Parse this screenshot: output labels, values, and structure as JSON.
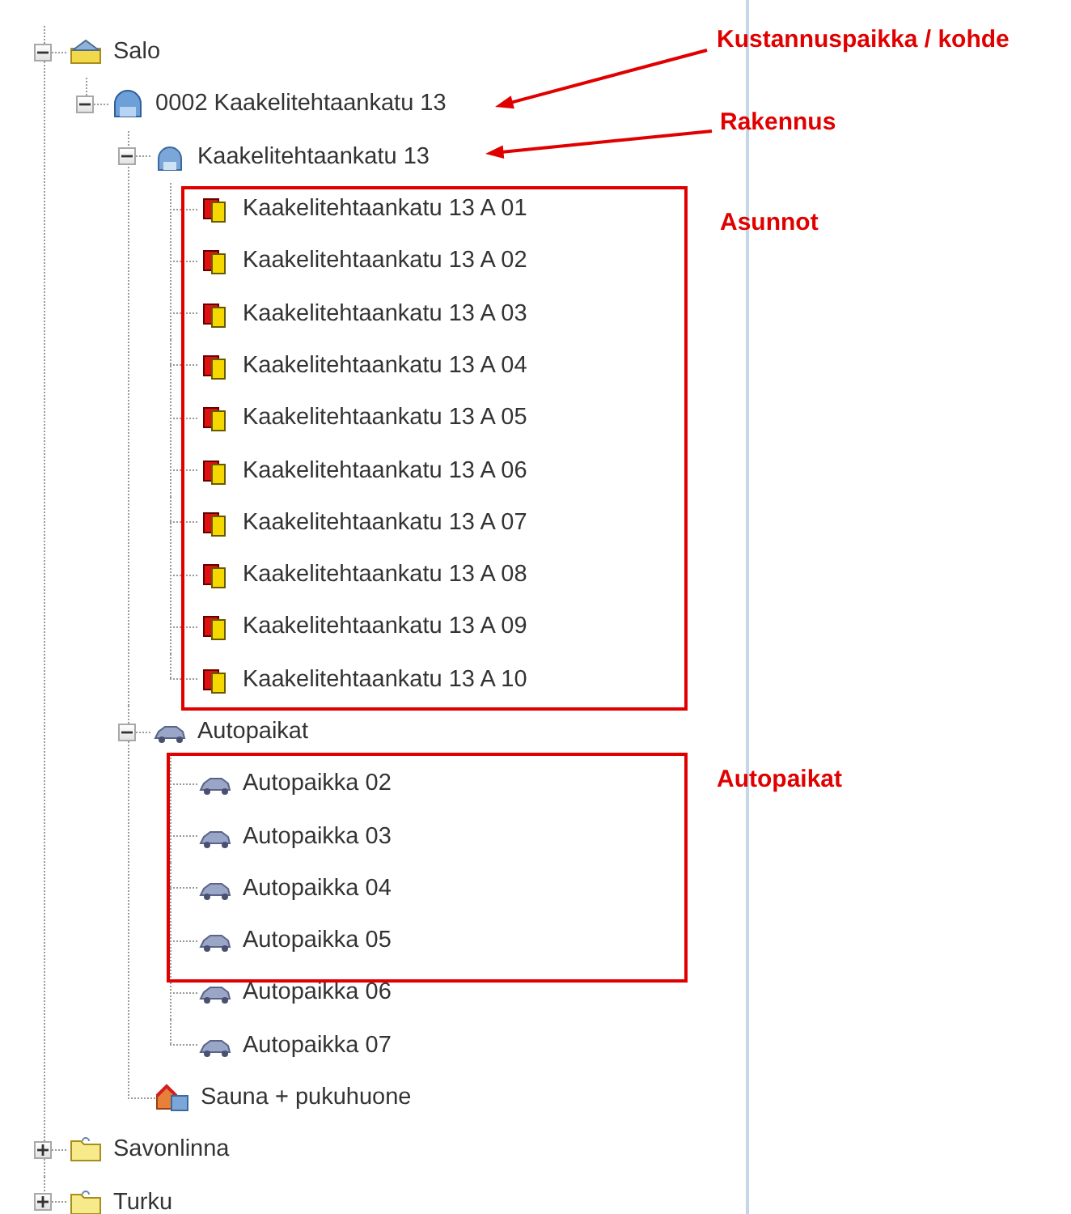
{
  "tree": [
    {
      "label": "Salo",
      "kind": "city",
      "expanded": true,
      "children": [
        {
          "label": "0002 Kaakelitehtaankatu 13",
          "kind": "property",
          "expanded": true,
          "children": [
            {
              "label": "Kaakelitehtaankatu 13",
              "kind": "building",
              "expanded": true,
              "children": [
                {
                  "label": "Kaakelitehtaankatu 13 A 01",
                  "kind": "apartment"
                },
                {
                  "label": "Kaakelitehtaankatu 13 A 02",
                  "kind": "apartment"
                },
                {
                  "label": "Kaakelitehtaankatu 13 A 03",
                  "kind": "apartment"
                },
                {
                  "label": "Kaakelitehtaankatu 13 A 04",
                  "kind": "apartment"
                },
                {
                  "label": "Kaakelitehtaankatu 13 A 05",
                  "kind": "apartment"
                },
                {
                  "label": "Kaakelitehtaankatu 13 A 06",
                  "kind": "apartment"
                },
                {
                  "label": "Kaakelitehtaankatu 13 A 07",
                  "kind": "apartment"
                },
                {
                  "label": "Kaakelitehtaankatu 13 A 08",
                  "kind": "apartment"
                },
                {
                  "label": "Kaakelitehtaankatu 13 A 09",
                  "kind": "apartment"
                },
                {
                  "label": "Kaakelitehtaankatu 13 A 10",
                  "kind": "apartment"
                }
              ]
            },
            {
              "label": "Autopaikat",
              "kind": "car",
              "expanded": true,
              "children": [
                {
                  "label": "Autopaikka 02",
                  "kind": "car"
                },
                {
                  "label": "Autopaikka 03",
                  "kind": "car"
                },
                {
                  "label": "Autopaikka 04",
                  "kind": "car"
                },
                {
                  "label": "Autopaikka 05",
                  "kind": "car"
                },
                {
                  "label": "Autopaikka 06",
                  "kind": "car"
                },
                {
                  "label": "Autopaikka 07",
                  "kind": "car"
                }
              ]
            },
            {
              "label": "Sauna + pukuhuone",
              "kind": "sauna"
            }
          ]
        }
      ]
    },
    {
      "label": "Savonlinna",
      "kind": "folder",
      "expanded": false
    },
    {
      "label": "Turku",
      "kind": "folder",
      "expanded": false
    }
  ],
  "annotations": [
    {
      "text": "Kustannuspaikka / kohde",
      "kind": "arrow"
    },
    {
      "text": "Rakennus",
      "kind": "arrow"
    },
    {
      "text": "Asunnot",
      "kind": "box"
    },
    {
      "text": "Autopaikat",
      "kind": "box"
    }
  ]
}
